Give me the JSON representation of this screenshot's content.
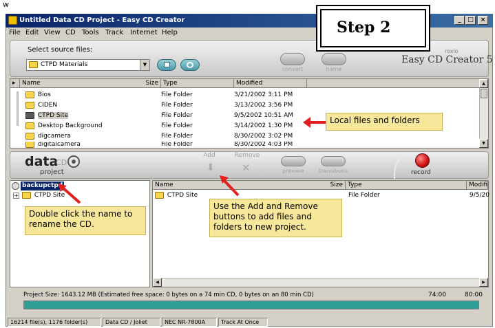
{
  "window": {
    "title": "Untitled Data CD Project - Easy CD Creator",
    "buttons": [
      "_",
      "□",
      "×"
    ]
  },
  "menu": [
    "File",
    "Edit",
    "View",
    "CD",
    "Tools",
    "Track",
    "Internet",
    "Help"
  ],
  "source": {
    "label": "Select source files:",
    "selected": "CTPD Materials",
    "convert_label": "convert",
    "name_label": "name"
  },
  "brand": {
    "small": "roxio",
    "name": "Easy CD Creator 5"
  },
  "source_list": {
    "columns": [
      "Name",
      "Size",
      "Type",
      "Modified"
    ],
    "rows": [
      {
        "name": "Bios",
        "type": "File Folder",
        "modified": "3/21/2002 3:11 PM"
      },
      {
        "name": "CIDEN",
        "type": "File Folder",
        "modified": "3/13/2002 3:56 PM"
      },
      {
        "name": "CTPD Site",
        "type": "File Folder",
        "modified": "9/5/2002 10:51 AM"
      },
      {
        "name": "Desktop Background",
        "type": "File Folder",
        "modified": "3/14/2002 1:30 PM"
      },
      {
        "name": "digcamera",
        "type": "File Folder",
        "modified": "8/30/2002 3:02 PM"
      },
      {
        "name": "digitalcamera",
        "type": "File Folder",
        "modified": "8/30/2002 4:03 PM"
      }
    ]
  },
  "project_bar": {
    "logo_main": "data",
    "logo_cd": "CD",
    "logo_sub": "project",
    "add_label": "Add",
    "remove_label": "Remove",
    "preview_label": "preview",
    "transitions_label": "transitions",
    "record_label": "record"
  },
  "tree": {
    "root": "backupctpd",
    "child": "CTPD Site"
  },
  "project_list": {
    "columns": [
      "Name",
      "Size",
      "Type",
      "Modifi"
    ],
    "rows": [
      {
        "name": "CTPD Site",
        "type": "File Folder",
        "modified": "9/5/20"
      }
    ]
  },
  "project_size": {
    "text": "Project Size: 1643.12 MB   (Estimated free space: 0 bytes on a 74 min CD,  0 bytes on an 80 min CD)",
    "mark_74": "74:00",
    "mark_80": "80:00"
  },
  "statusbar": [
    "16214 file(s), 1176 folder(s)",
    "Data CD / Joliet",
    "NEC NR-7800A",
    "Track At Once"
  ],
  "annotations": {
    "step": "Step 2",
    "local": "Local files and folders",
    "rename": "Double click the name to rename the CD.",
    "addremove": "Use the Add and Remove buttons to add files and folders to new project."
  },
  "colors": {
    "callout_bg": "#f7e79a",
    "arrow": "#e02020",
    "selection": "#0a246a",
    "progress": "#2f9e96"
  }
}
